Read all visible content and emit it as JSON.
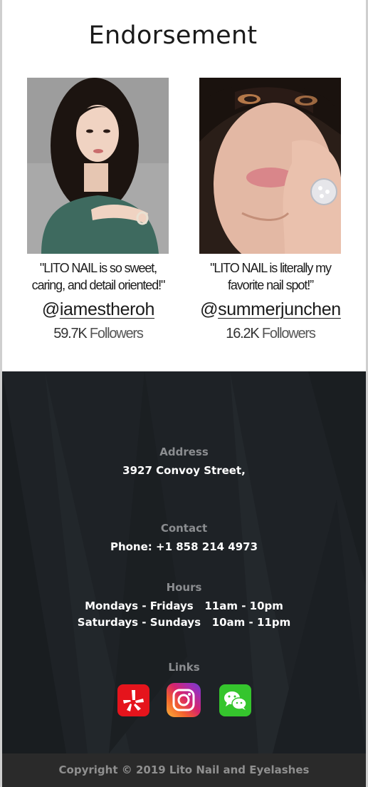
{
  "endorsement": {
    "title": "Endorsement",
    "cards": [
      {
        "quote_line1": "\"LITO NAIL is so sweet,",
        "quote_line2": "caring, and detail oriented!\"",
        "handle_at": "@",
        "handle_name": "iamestheroh",
        "followers_count": "59.7K",
        "followers_label": " Followers"
      },
      {
        "quote_line1": "\"LITO NAIL is literally my",
        "quote_line2": "favorite nail spot!”",
        "handle_at": "@",
        "handle_name": "summerjunchen",
        "followers_count": "16.2K",
        "followers_label": " Followers"
      }
    ]
  },
  "footer": {
    "address_label": "Address",
    "address_value": "3927 Convoy Street,",
    "contact_label": "Contact",
    "contact_value": "Phone: +1 858 214 4973",
    "hours_label": "Hours",
    "hours_line1": "Mondays - Fridays   11am - 10pm",
    "hours_line2": "Saturdays - Sundays   10am - 11pm",
    "links_label": "Links",
    "links": [
      {
        "icon": "yelp-icon",
        "color": "#e5141c"
      },
      {
        "icon": "instagram-icon",
        "color": "#d8256a"
      },
      {
        "icon": "wechat-icon",
        "color": "#35c52d"
      }
    ],
    "copyright": "Copyright © 2019 Lito Nail and Eyelashes"
  }
}
